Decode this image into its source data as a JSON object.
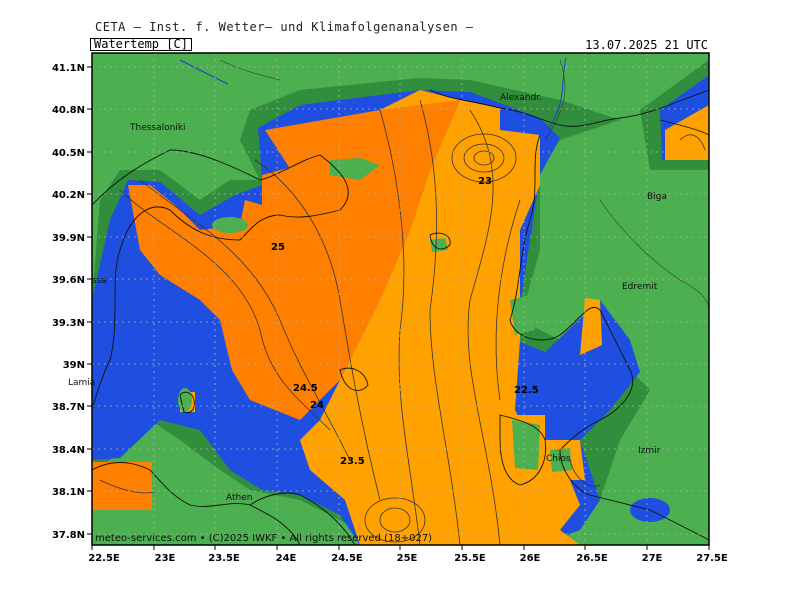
{
  "header": {
    "title": "CETA – Inst. f. Wetter– und Klimafolgenanalysen –",
    "param": "Watertemp_[C]",
    "datetime": "13.07.2025 21 UTC"
  },
  "footer": {
    "credit": "meteo-services.com • (C)2025 IWKF • All rights reserved (18+027)"
  },
  "map": {
    "lon_range": [
      22.5,
      27.5
    ],
    "lat_range": [
      37.7,
      41.3
    ],
    "x_ticks": [
      "22.5E",
      "23E",
      "23.5E",
      "24E",
      "24.5E",
      "25E",
      "25.5E",
      "26E",
      "26.5E",
      "27E",
      "27.5E"
    ],
    "y_ticks": [
      "41.1N",
      "40.8N",
      "40.5N",
      "40.2N",
      "39.9N",
      "39.6N",
      "39.3N",
      "39N",
      "38.7N",
      "38.4N",
      "38.1N",
      "37.8N"
    ],
    "colors": {
      "land": "#4caf50",
      "coast_dark": "#2e7d32",
      "shallow": "#1f4fe0",
      "water_warm": "#ff7f00",
      "water_mild": "#ffa200",
      "grid": "#9e9e9e"
    },
    "cities": [
      {
        "name": "Thessaloniki",
        "lon": 22.95,
        "lat": 40.64
      },
      {
        "name": "Alexandr.",
        "lon": 25.87,
        "lat": 40.85
      },
      {
        "name": "Biga",
        "lon": 27.23,
        "lat": 40.23
      },
      {
        "name": "Edremit",
        "lon": 27.02,
        "lat": 39.59
      },
      {
        "name": "Lamia",
        "lon": 22.43,
        "lat": 38.9
      },
      {
        "name": "Athen",
        "lon": 23.73,
        "lat": 37.98
      },
      {
        "name": "Chios",
        "lon": 26.14,
        "lat": 38.37
      },
      {
        "name": "Izmir",
        "lon": 27.14,
        "lat": 38.42
      },
      {
        "name": "ssa",
        "lon": 22.42,
        "lat": 39.64
      }
    ],
    "isotherm_labels": [
      {
        "text": "25",
        "lon": 23.88,
        "lat": 39.84
      },
      {
        "text": "23",
        "lon": 25.65,
        "lat": 40.28
      },
      {
        "text": "24.5",
        "lon": 24.15,
        "lat": 38.81
      },
      {
        "text": "24",
        "lon": 24.25,
        "lat": 38.68
      },
      {
        "text": "22.5",
        "lon": 25.98,
        "lat": 38.79
      },
      {
        "text": "23.5",
        "lon": 24.55,
        "lat": 38.25
      }
    ]
  }
}
